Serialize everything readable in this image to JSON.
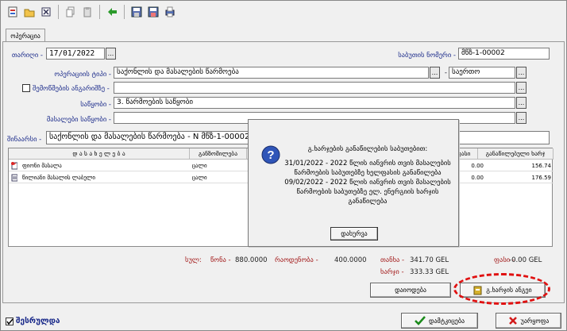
{
  "toolbar": {
    "icons": [
      "new-doc-icon",
      "open-folder-icon",
      "delete-icon",
      "copy-icon",
      "paste-icon",
      "back-arrow-icon",
      "save-icon",
      "save-as-icon",
      "print-icon"
    ]
  },
  "tab": {
    "label": "ოპერაცია"
  },
  "form": {
    "date_label": "თარიღი -",
    "date_value": "17/01/2022",
    "doc_no_label": "საბუთის ნომერი -",
    "doc_no_value": "მწზ-1-00002",
    "op_type_label": "ოპერაციის ტიპი -",
    "op_type_value": "საქონლის და მასალების წარმოება",
    "op_sub_value": "საერთო",
    "check_label": "შემოწმების ანგარიშზე -",
    "warehouse_label": "საწყობი -",
    "warehouse_value": "3. წარმოების საწყობი",
    "mat_warehouse_label": "მასალები საწყობი -",
    "mat_warehouse_value": "",
    "content_label": "შინაარსი -",
    "content_value": "საქონლის და მასალების წარმოება - N მწზ-1-00002"
  },
  "grid": {
    "columns": [
      "დ ა ს ა ხ ე ლ ე ბ ა",
      "განზომილება",
      "ფასი",
      "განაწილებული ხარჯ"
    ],
    "rows": [
      {
        "name": "ფიონი მასალა",
        "unit": "ცალი",
        "price": "0.00",
        "cost": "156.74"
      },
      {
        "name": "წილიანი მასალის ლაბელი",
        "unit": "ცალი",
        "price": "0.00",
        "cost": "176.59"
      }
    ]
  },
  "summary": {
    "total_label": "სულ:",
    "weight_label": "წონა -",
    "weight_value": "880.0000",
    "qty_label": "რაოდენობა -",
    "qty_value": "400.0000",
    "amount_label": "თანხა -",
    "amount_value": "341.70 GEL",
    "price_label": "ფასი -",
    "price_value": "-0.00 GEL",
    "cost_label": "ხარჯი -",
    "cost_value": "333.33 GEL"
  },
  "buttons": {
    "distribute": "დაიოდება",
    "cost_calc": "გ.ხარჯის ანგეი",
    "confirm": "დამტკიცება",
    "cancel": "უარყოფა",
    "posted": "შესრულდა"
  },
  "modal": {
    "title": "გ.ხარჯების განაწილების საბუთებით:",
    "lines": [
      "31/01/2022 - 2022 წლის იანვრის თვის მასალების",
      "წარმოების საბუთებზე ხელფასის განაწილება",
      "09/02/2022 - 2022 წლის იანვრის თვის მასალების",
      "წარმოების საბუთებზე ელ. ენერგიის ხარჯის",
      "განაწილება"
    ],
    "ok": "დახურვა"
  },
  "colors": {
    "accent_red": "#e01010",
    "label_blue": "#1a2a8a",
    "sum_red": "#a21818"
  }
}
